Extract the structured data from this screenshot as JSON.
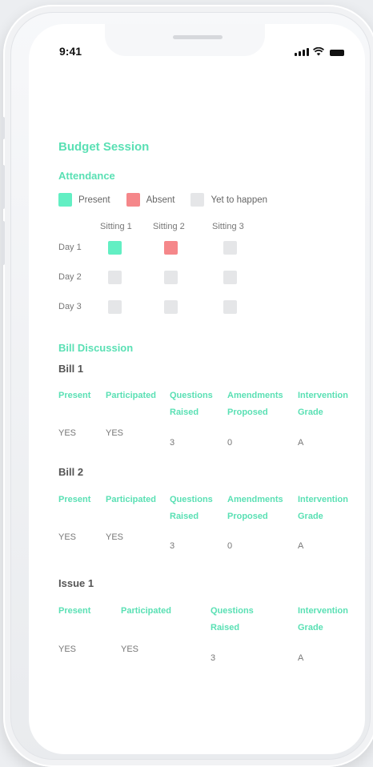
{
  "status": {
    "time": "9:41"
  },
  "title": "Budget Session",
  "attendance": {
    "heading": "Attendance",
    "legend": [
      {
        "label": "Present",
        "color": "#62efc3"
      },
      {
        "label": "Absent",
        "color": "#f5878a"
      },
      {
        "label": "Yet to happen",
        "color": "#e5e6e8"
      }
    ],
    "columns": [
      "Sitting 1",
      "Sitting 2",
      "Sitting 3"
    ],
    "rows": [
      {
        "label": "Day 1",
        "cells": [
          "present",
          "absent",
          "pending"
        ]
      },
      {
        "label": "Day 2",
        "cells": [
          "pending",
          "pending",
          "pending"
        ]
      },
      {
        "label": "Day 3",
        "cells": [
          "pending",
          "pending",
          "pending"
        ]
      }
    ]
  },
  "bill_discussion": {
    "heading": "Bill Discussion",
    "bill1": {
      "title": "Bill 1",
      "headers": [
        "Present",
        "Participated",
        "Questions Raised",
        "Amendments Proposed",
        "Intervention Grade"
      ],
      "values": [
        "YES",
        "YES",
        "3",
        "0",
        "A"
      ]
    },
    "bill2": {
      "title": "Bill 2",
      "headers": [
        "Present",
        "Participated",
        "Questions Raised",
        "Amendments Proposed",
        "Intervention Grade"
      ],
      "values": [
        "YES",
        "YES",
        "3",
        "0",
        "A"
      ]
    },
    "issue1": {
      "title": "Issue 1",
      "headers": [
        "Present",
        "Participated",
        "Questions Raised",
        "Intervention Grade"
      ],
      "values": [
        "YES",
        "YES",
        "3",
        "A"
      ]
    }
  }
}
